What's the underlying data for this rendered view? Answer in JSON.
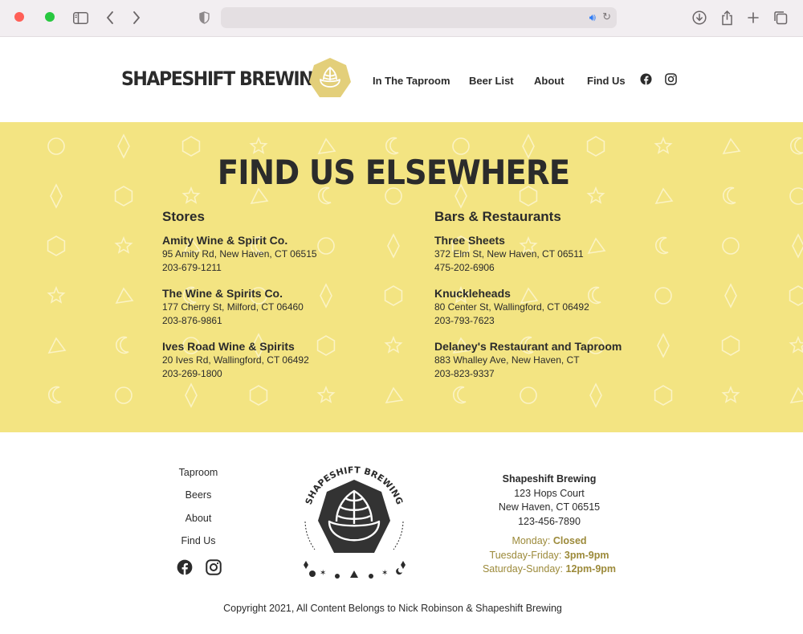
{
  "site": {
    "logo_text": "SHAPESHIFT BREWING",
    "nav": [
      "In The Taproom",
      "Beer List",
      "About",
      "Find Us"
    ],
    "accent_yellow": "#f3e482",
    "badge_color": "#e3cf7a"
  },
  "find_us": {
    "title": "FIND US ELSEWHERE",
    "stores": {
      "heading": "Stores",
      "items": [
        {
          "name": "Amity Wine & Spirit Co.",
          "address": "95 Amity Rd, New Haven, CT 06515",
          "phone": "203-679-1211"
        },
        {
          "name": "The Wine & Spirits Co.",
          "address": "177 Cherry St, Milford, CT 06460",
          "phone": "203-876-9861"
        },
        {
          "name": "Ives Road Wine & Spirits",
          "address": "20 Ives Rd, Wallingford, CT 06492",
          "phone": "203-269-1800"
        }
      ]
    },
    "bars": {
      "heading": "Bars & Restaurants",
      "items": [
        {
          "name": "Three Sheets",
          "address": "372 Elm St, New Haven, CT 06511",
          "phone": "475-202-6906"
        },
        {
          "name": "Knuckleheads",
          "address": "80 Center St, Wallingford, CT 06492",
          "phone": "203-793-7623"
        },
        {
          "name": "Delaney's Restaurant and Taproom",
          "address": "883 Whalley Ave, New Haven, CT",
          "phone": "203-823-9337"
        }
      ]
    }
  },
  "footer": {
    "links": [
      "Taproom",
      "Beers",
      "About",
      "Find Us"
    ],
    "emblem_text": "SHAPESHIFT BREWING",
    "address": {
      "name": "Shapeshift Brewing",
      "street": "123 Hops Court",
      "city": "New Haven, CT 06515",
      "phone": "123-456-7890"
    },
    "hours": [
      {
        "days": "Monday:",
        "time": "Closed"
      },
      {
        "days": "Tuesday-Friday:",
        "time": "3pm-9pm"
      },
      {
        "days": "Saturday-Sunday:",
        "time": "12pm-9pm"
      }
    ],
    "copyright": "Copyright 2021, All Content Belongs to Nick Robinson & Shapeshift Brewing"
  }
}
